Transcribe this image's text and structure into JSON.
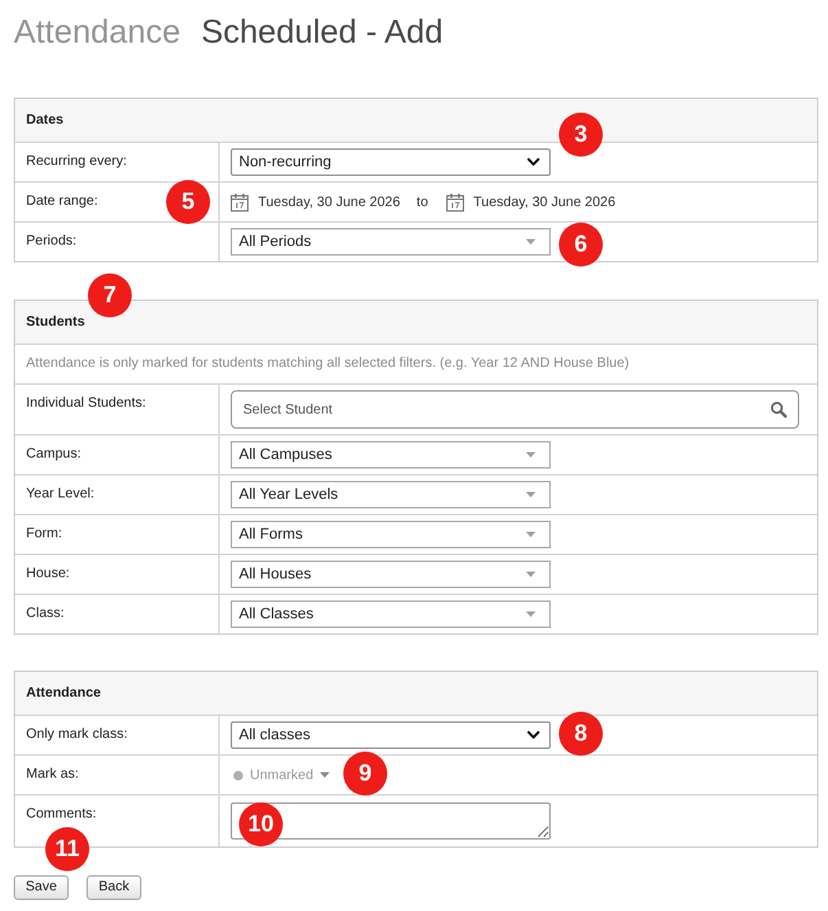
{
  "page_title": {
    "section": "Attendance",
    "title": "Scheduled - Add"
  },
  "sections": [
    {
      "title": "Dates",
      "rows": [
        {
          "kind": "select",
          "label": "Recurring every:",
          "value": "Non-recurring",
          "callout": "3"
        },
        {
          "kind": "date_range",
          "label": "Date range:",
          "start": "Tuesday, 30 June 2026",
          "separator": "to",
          "end": "Tuesday, 30 June 2026",
          "callout": "5"
        },
        {
          "kind": "dropdown",
          "label": "Periods:",
          "value": "All Periods",
          "callout": "6"
        }
      ]
    },
    {
      "title": "Students",
      "callout": "7",
      "note": "Attendance is only marked for students matching all selected filters. (e.g. Year 12 AND House Blue)",
      "rows": [
        {
          "kind": "search",
          "label": "Individual Students:",
          "placeholder": "Select Student"
        },
        {
          "kind": "dropdown",
          "label": "Campus:",
          "value": "All Campuses"
        },
        {
          "kind": "dropdown",
          "label": "Year Level:",
          "value": "All Year Levels"
        },
        {
          "kind": "dropdown",
          "label": "Form:",
          "value": "All Forms"
        },
        {
          "kind": "dropdown",
          "label": "House:",
          "value": "All Houses"
        },
        {
          "kind": "dropdown",
          "label": "Class:",
          "value": "All Classes"
        }
      ]
    },
    {
      "title": "Attendance",
      "rows": [
        {
          "kind": "select",
          "label": "Only mark class:",
          "value": "All classes",
          "callout": "8"
        },
        {
          "kind": "status",
          "label": "Mark as:",
          "value": "Unmarked",
          "callout": "9"
        },
        {
          "kind": "textarea",
          "label": "Comments:",
          "callout": "10"
        }
      ]
    }
  ],
  "buttons": [
    {
      "label": "Save",
      "callout": "11"
    },
    {
      "label": "Back"
    }
  ]
}
